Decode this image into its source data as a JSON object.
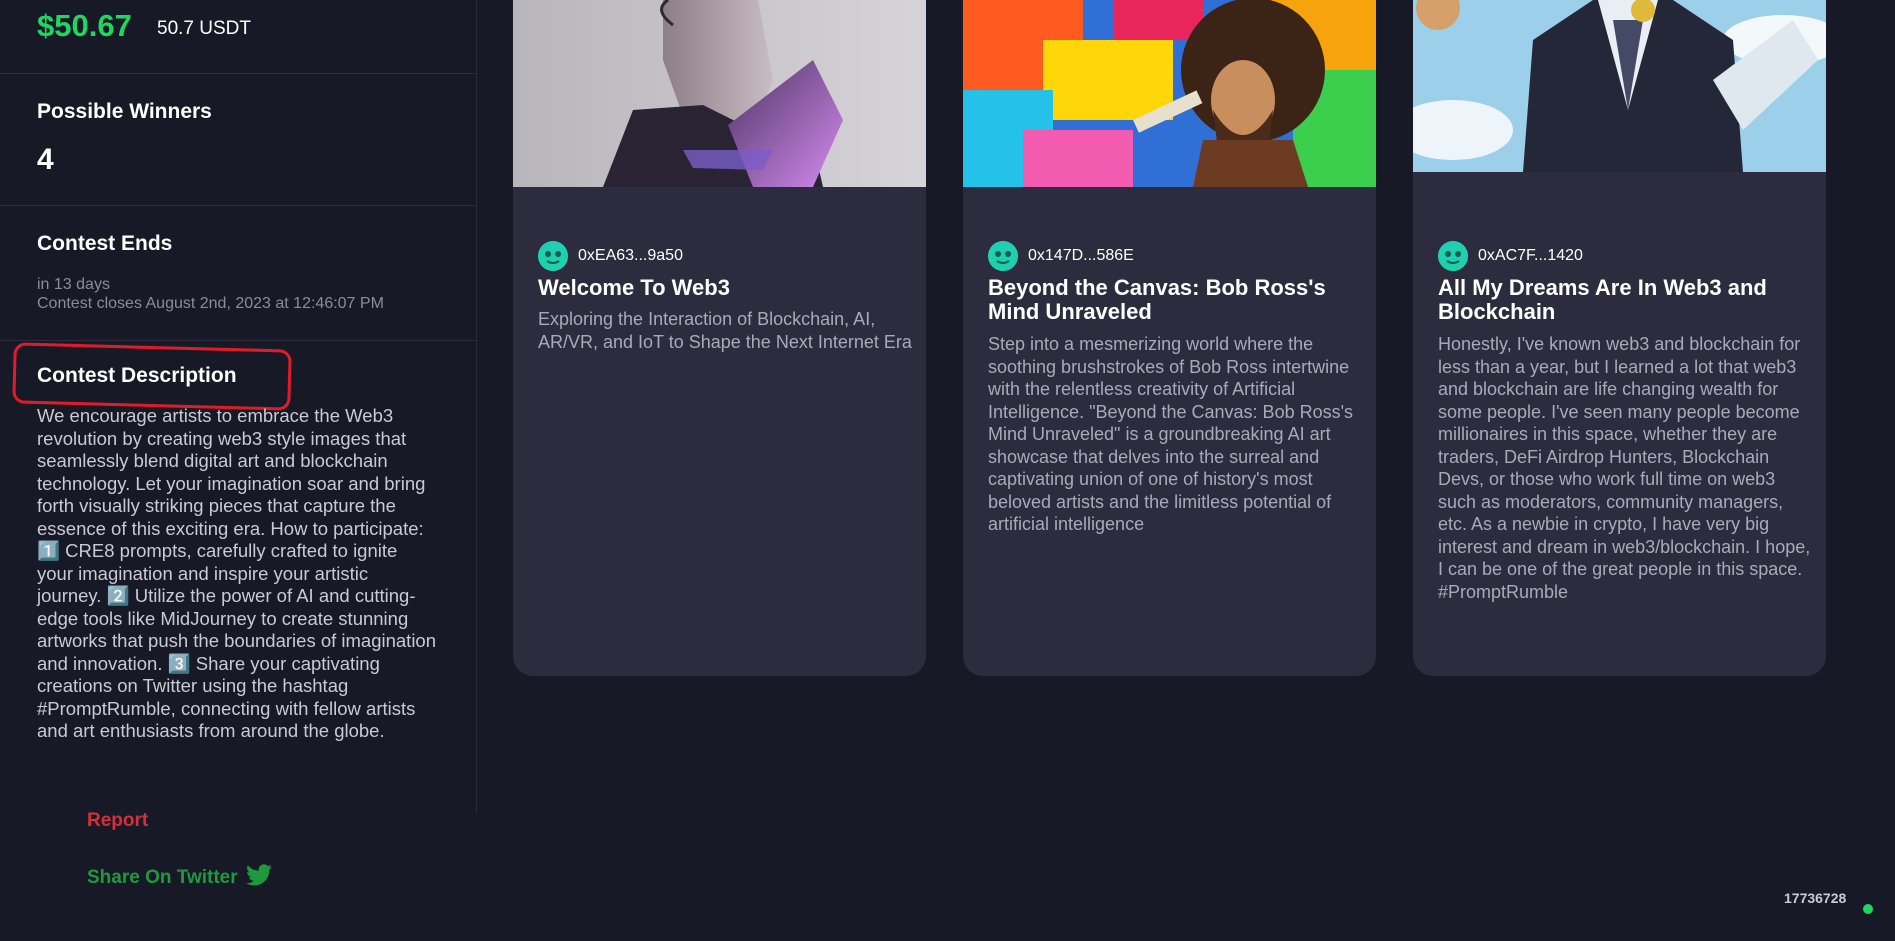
{
  "sidebar": {
    "prize_usd": "$50.67",
    "prize_token": "50.7 USDT",
    "winners_label": "Possible Winners",
    "winners_value": "4",
    "ends_label": "Contest Ends",
    "ends_relative": "in 13 days",
    "ends_exact": "Contest closes August 2nd, 2023 at 12:46:07 PM",
    "description_label": "Contest Description",
    "description": "We encourage artists to embrace the Web3 revolution by creating web3 style images that seamlessly blend digital art and blockchain technology. Let your imagination soar and bring forth visually striking pieces that capture the essence of this exciting era. How to participate: 1️⃣ CRE8 prompts, carefully crafted to ignite your imagination and inspire your artistic journey. 2️⃣ Utilize the power of AI and cutting-edge tools like MidJourney to create stunning artworks that push the boundaries of imagination and innovation. 3️⃣ Share your captivating creations on Twitter using the hashtag #PromptRumble, connecting with fellow artists and art enthusiasts from around the globe.",
    "report_label": "Report",
    "share_label": "Share On Twitter",
    "highlight_color": "#e11c2a"
  },
  "cards": [
    {
      "author": "0xEA63...9a50",
      "title": "Welcome To Web3",
      "body": "Exploring the Interaction of Blockchain, AI, AR/VR, and IoT to Shape the Next Internet Era",
      "image_icon": "purple-robot-portrait"
    },
    {
      "author": "0x147D...586E",
      "title": "Beyond the Canvas: Bob Ross's Mind Unraveled",
      "body": "Step into a mesmerizing world where the soothing brushstrokes of Bob Ross intertwine with the relentless creativity of Artificial Intelligence. \"Beyond the Canvas: Bob Ross's Mind Unraveled\" is a groundbreaking AI art showcase that delves into the surreal and captivating union of one of history's most beloved artists and the limitless potential of artificial intelligence",
      "image_icon": "colorful-painter-portrait"
    },
    {
      "author": "0xAC7F...1420",
      "title": "All My Dreams Are In Web3 and Blockchain",
      "body": "Honestly, I've known web3 and blockchain for less than a year, but I learned a lot that web3 and blockchain are life changing wealth for some people. I've seen many people become millionaires in this space, whether they are traders, DeFi Airdrop Hunters, Blockchain Devs, or those who work full time on web3 such as moderators, community managers, etc. As a newbie in crypto, I have very big interest and dream in web3/blockchain. I hope, I can be one of the great people in this space. #PromptRumble",
      "image_icon": "man-in-suit-portrait"
    }
  ],
  "footer": {
    "block_number": "17736728",
    "status_color": "#1ed760"
  }
}
